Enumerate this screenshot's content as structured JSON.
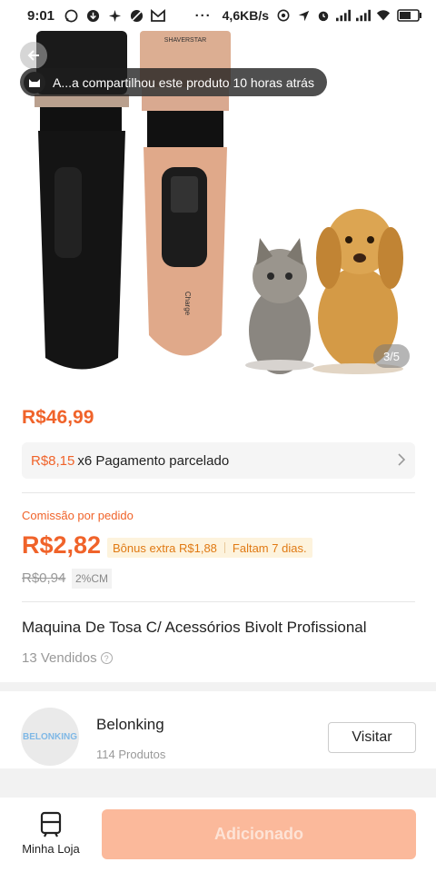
{
  "status_bar": {
    "time": "9:01",
    "speed": "4,6KB/s",
    "dots": "···",
    "left_icons": [
      "whatsapp-icon",
      "download-icon",
      "pinwheel-icon",
      "no-disturb-icon",
      "gmail-icon"
    ],
    "right_icons": [
      "vpn-icon",
      "location-icon",
      "alarm-icon",
      "signal-icon",
      "signal-icon",
      "wifi-icon",
      "battery-icon"
    ]
  },
  "hero": {
    "share_text": "A...a compartilhou este produto 10 horas atrás",
    "image_counter": "3/5",
    "clipper_brand": "SHAVERSTAR",
    "clipper_label": "Charge"
  },
  "price": {
    "main": "R$46,99",
    "installment_price": "R$8,15",
    "installment_text": "x6 Pagamento parcelado"
  },
  "commission": {
    "label": "Comissão por pedido",
    "value": "R$2,82",
    "bonus": "Bônus extra R$1,88",
    "remaining": "Faltam 7 dias.",
    "old_value": "R$0,94",
    "percent": "2%CM"
  },
  "product": {
    "title": "Maquina De Tosa C/ Acessórios Bivolt Profissional",
    "sold": "13 Vendidos"
  },
  "shop": {
    "logo_text": "BELONKING",
    "name": "Belonking",
    "products": "114 Produtos",
    "visit_label": "Visitar"
  },
  "bottom": {
    "store_label": "Minha Loja",
    "add_label": "Adicionado"
  },
  "colors": {
    "accent": "#f0632a",
    "add_button": "#fbb99b",
    "bonus_bg": "#fdf3dd"
  }
}
